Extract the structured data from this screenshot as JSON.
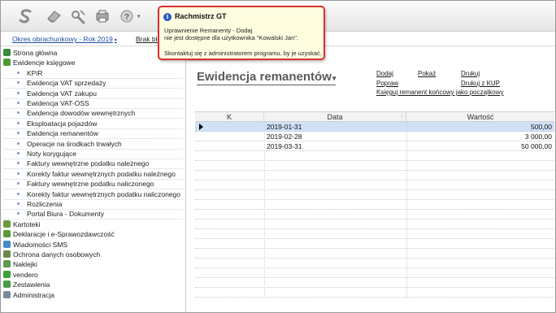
{
  "toolbar": {
    "icons": [
      "logo-s-icon",
      "eraser-icon",
      "tools-icon",
      "printer-icon",
      "help-icon"
    ],
    "colors": {
      "icon_gray": "#8a8a8a"
    }
  },
  "subbar": {
    "period_label": "Okres obrachunkowy - Rok 2019",
    "brak_label": "Brak blo"
  },
  "sidebar": {
    "items": [
      {
        "label": "Strona główna",
        "kind": "top",
        "icon": "home-icon",
        "color": "#3a8a3a"
      },
      {
        "label": "Ewidencje księgowe",
        "kind": "top",
        "icon": "book-icon",
        "color": "#4e9a32"
      },
      {
        "label": "KPiR",
        "kind": "sub"
      },
      {
        "label": "Ewidencja VAT sprzedaży",
        "kind": "sub"
      },
      {
        "label": "Ewidencja VAT zakupu",
        "kind": "sub"
      },
      {
        "label": "Ewidencja VAT-OSS",
        "kind": "sub"
      },
      {
        "label": "Ewidencja dowodów wewnętrznych",
        "kind": "sub"
      },
      {
        "label": "Eksploatacja pojazdów",
        "kind": "sub"
      },
      {
        "label": "Ewidencja remanentów",
        "kind": "sub"
      },
      {
        "label": "Operacje na środkach trwałych",
        "kind": "sub"
      },
      {
        "label": "Noty korygujące",
        "kind": "sub"
      },
      {
        "label": "Faktury wewnętrzne podatku należnego",
        "kind": "sub"
      },
      {
        "label": "Korekty faktur wewnętrznych podatku należnego",
        "kind": "sub"
      },
      {
        "label": "Faktury wewnętrzne podatku naliczonego",
        "kind": "sub"
      },
      {
        "label": "Korekty faktur wewnętrznych podatku naliczonego",
        "kind": "sub"
      },
      {
        "label": "Rozliczenia",
        "kind": "sub"
      },
      {
        "label": "Portal Biura - Dokumenty",
        "kind": "sub"
      },
      {
        "label": "Kartoteki",
        "kind": "top",
        "icon": "cards-icon",
        "color": "#6a9a3a"
      },
      {
        "label": "Deklaracje i e-Sprawozdawczość",
        "kind": "top",
        "icon": "declaration-icon",
        "color": "#5a9a3a"
      },
      {
        "label": "Wiadomości SMS",
        "kind": "top",
        "icon": "sms-icon",
        "color": "#4a8ac8"
      },
      {
        "label": "Ochrona danych osobowych",
        "kind": "top",
        "icon": "shield-icon",
        "color": "#6a8a4a"
      },
      {
        "label": "Naklejki",
        "kind": "top",
        "icon": "sticker-icon",
        "color": "#5a9a4a"
      },
      {
        "label": "vendero",
        "kind": "top",
        "icon": "vendero-icon",
        "color": "#3aa03a"
      },
      {
        "label": "Zestawienia",
        "kind": "top",
        "icon": "report-icon",
        "color": "#4a9a4a"
      },
      {
        "label": "Administracja",
        "kind": "top",
        "icon": "admin-icon",
        "color": "#7a8a9a"
      }
    ]
  },
  "main": {
    "title": "Ewidencja remanentów",
    "title_caret": "▾",
    "links": {
      "dodaj": "Dodaj",
      "popraw": "Popraw",
      "pokaz": "Pokaż",
      "drukuj": "Drukuj",
      "drukuj_kup": "Drukuj z KUP",
      "wprowadz": "Księguj remanent końcowy jako początkowy"
    },
    "columns": [
      "K",
      "Data",
      "Wartość"
    ],
    "rows": [
      {
        "k": "",
        "data": "2019-01-31",
        "wartosc": "500,00",
        "selected": true
      },
      {
        "k": "",
        "data": "2019-02-28",
        "wartosc": "3 000,00",
        "selected": false
      },
      {
        "k": "",
        "data": "2019-03-31",
        "wartosc": "50 000,00",
        "selected": false
      }
    ]
  },
  "tooltip": {
    "title": "Rachmistrz GT",
    "line1": "Uprawnienie Remanenty - Dodaj",
    "line2": "nie jest dostępne dla użytkownika \"Kowalski Jan\".",
    "line3": "Skontaktuj się z administratorem programu, by je uzyskać.",
    "border_color": "#d63232"
  }
}
